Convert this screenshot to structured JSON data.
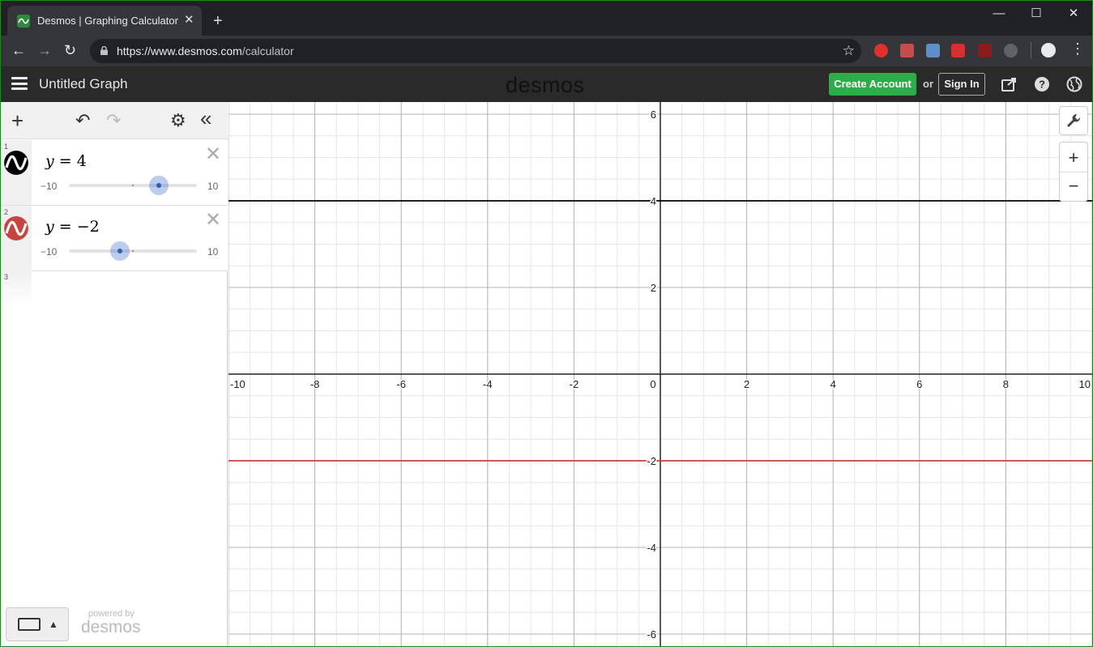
{
  "browser": {
    "tab_title": "Desmos | Graphing Calculator",
    "tab_close": "✕",
    "new_tab": "+",
    "url_host": "https://www.desmos.com",
    "url_path": "/calculator",
    "minimize": "—",
    "maximize": "☐",
    "close": "✕",
    "back": "←",
    "forward": "→",
    "reload": "↻",
    "star": "☆",
    "menu": "⋮",
    "extension_colors": [
      "#e0302a",
      "#c94b4b",
      "#5f8fc9",
      "#d62f2f",
      "#8a1c1c",
      "#5f6368"
    ]
  },
  "header": {
    "graph_title": "Untitled Graph",
    "logo": "desmos",
    "create_account": "Create Account",
    "or": "or",
    "sign_in": "Sign In"
  },
  "panel": {
    "add": "+",
    "undo": "↶",
    "redo": "↷",
    "settings": "⚙",
    "collapse": "«",
    "expressions": [
      {
        "num": "1",
        "var": "y",
        "rel": " = ",
        "value": "4",
        "color": "#000000",
        "slider_min": "−10",
        "slider_max": "10",
        "slider_value": 4
      },
      {
        "num": "2",
        "var": "y",
        "rel": " = ",
        "value": "−2",
        "color": "#c74440",
        "slider_min": "−10",
        "slider_max": "10",
        "slider_value": -2
      }
    ],
    "next_num": "3",
    "keypad_caret": "▲",
    "powered_by": "powered by",
    "powered_logo": "desmos"
  },
  "graph": {
    "zoom_in": "+",
    "zoom_out": "−",
    "wrench": "wrench-icon"
  },
  "chart_data": {
    "type": "line",
    "xlim": [
      -10,
      10
    ],
    "ylim": [
      -6.3,
      6.3
    ],
    "grid": true,
    "x_ticks": [
      "-10",
      "-8",
      "-6",
      "-4",
      "-2",
      "0",
      "2",
      "4",
      "6",
      "8",
      "10"
    ],
    "y_ticks": [
      "6",
      "4",
      "2",
      "-2",
      "-4",
      "-6"
    ],
    "series": [
      {
        "x": [
          -10,
          10
        ],
        "y": [
          4,
          4
        ],
        "color": "#000000"
      },
      {
        "x": [
          -10,
          10
        ],
        "y": [
          -2,
          -2
        ],
        "color": "#c74440"
      }
    ]
  }
}
